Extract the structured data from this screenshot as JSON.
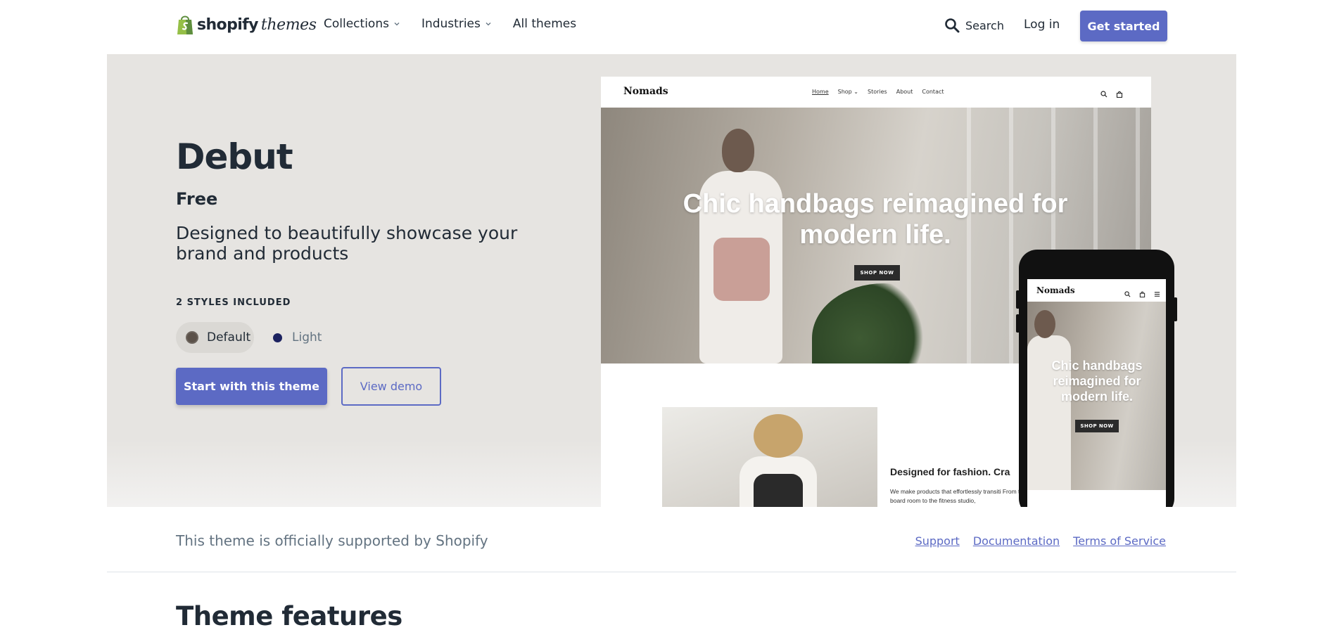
{
  "header": {
    "logo_word": "shopify",
    "logo_suffix": "themes",
    "nav": [
      {
        "label": "Collections",
        "has_dropdown": true
      },
      {
        "label": "Industries",
        "has_dropdown": true
      },
      {
        "label": "All themes",
        "has_dropdown": false
      }
    ],
    "search_label": "Search",
    "login_label": "Log in",
    "cta_label": "Get started"
  },
  "theme": {
    "name": "Debut",
    "price": "Free",
    "description": "Designed to beautifully showcase your brand and products",
    "styles_label": "2 STYLES INCLUDED",
    "styles": [
      {
        "label": "Default",
        "color": "#5b5149",
        "selected": true
      },
      {
        "label": "Light",
        "color": "#1c2260",
        "selected": false
      }
    ],
    "start_button": "Start with this theme",
    "demo_button": "View demo"
  },
  "preview": {
    "desktop": {
      "brand": "Nomads",
      "nav": [
        "Home",
        "Shop ⌄",
        "Stories",
        "About",
        "Contact"
      ],
      "headline": "Chic handbags reimagined for modern life.",
      "shop_button": "SHOP NOW",
      "section_title": "Designed for fashion. Cra",
      "section_text": "We make products that effortlessly transiti From the board room to the fitness studio,"
    },
    "mobile": {
      "brand": "Nomads",
      "headline": "Chic handbags reimagined for modern life.",
      "shop_button": "SHOP NOW"
    }
  },
  "support": {
    "text": "This theme is officially supported by Shopify",
    "links": [
      "Support",
      "Documentation",
      "Terms of Service"
    ]
  },
  "features": {
    "title": "Theme features"
  },
  "colors": {
    "accent": "#5c6ac4",
    "text": "#212b36",
    "muted": "#637381",
    "hero_bg": "#e6e4e1"
  },
  "icons": [
    "shopping-bag-icon",
    "chevron-down-icon",
    "search-icon",
    "cart-icon",
    "menu-icon"
  ]
}
